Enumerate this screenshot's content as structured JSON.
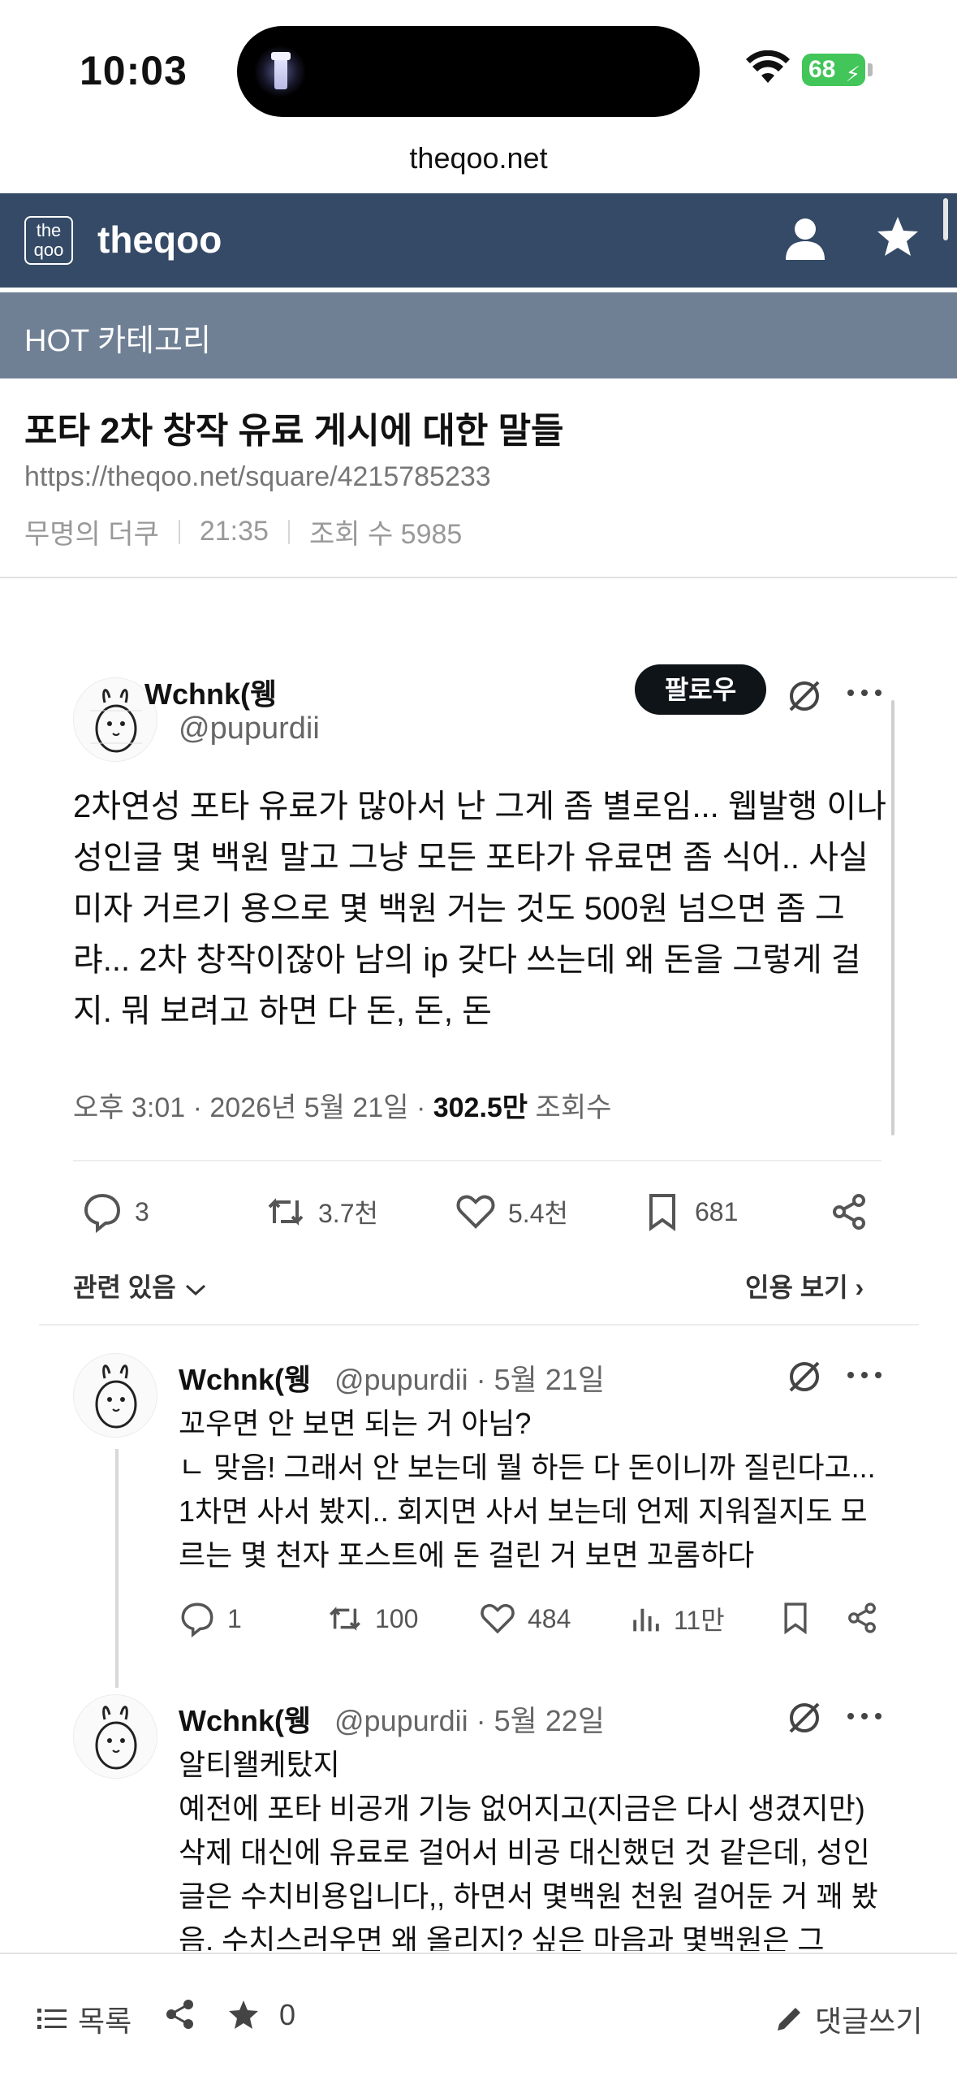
{
  "status_bar": {
    "time": "10:03",
    "battery": "68"
  },
  "browser": {
    "host": "theqoo.net"
  },
  "site": {
    "logo_text_top": "the",
    "logo_text_bottom": "qoo",
    "title": "theqoo",
    "icons": [
      "user-icon",
      "star-icon"
    ]
  },
  "category": {
    "label": "HOT 카테고리"
  },
  "article": {
    "title": "포타 2차 창작 유료 게시에 대한 말들",
    "url": "https://theqoo.net/square/4215785233",
    "author": "무명의 더쿠",
    "time": "21:35",
    "views": "조회 수 5985"
  },
  "tweet": {
    "name": "Wchnk(웽",
    "handle": "@pupurdii",
    "follow_label": "팔로우",
    "text": "2차연성 포타 유료가 많아서 난 그게 좀 별로임... 웹발행 이나 성인글 몇 백원 말고 그냥 모든 포타가 유료면 좀 식어.. 사실 미자 거르기 용으로 몇 백원 거는 것도 500원 넘으면 좀 그랴... 2차 창작이잖아 남의 ip 갖다 쓰는데 왜 돈을 그렇게 걸지. 뭐 보려고 하면 다 돈, 돈, 돈",
    "date": "오후 3:01 · 2026년 5월 21일 · ",
    "views_count": "302.5만",
    "views_label": " 조회수",
    "stats": {
      "replies": "3",
      "retweets": "3.7천",
      "likes": "5.4천",
      "bookmarks": "681"
    },
    "related_label": "관련 있음",
    "quote_label": "인용 보기 ›"
  },
  "replies": [
    {
      "name": "Wchnk(웽",
      "handle": "@pupurdii · 5월 21일",
      "text": "꼬우면 안 보면 되는 거 아님?\nㄴ 맞음! 그래서 안 보는데 뭘 하든 다 돈이니까 질린다고... 1차면 사서 봤지.. 회지면 사서 보는데 언제 지워질지도 모르는 몇 천자 포스트에 돈 걸린 거 보면 꼬롬하다",
      "stats": {
        "replies": "1",
        "retweets": "100",
        "likes": "484",
        "views": "11만"
      }
    },
    {
      "name": "Wchnk(웽",
      "handle": "@pupurdii · 5월 22일",
      "text": "알티왤케탔지\n예전에 포타 비공개 기능 없어지고(지금은 다시 생겼지만) 삭제 대신에 유료로 걸어서 비공 대신했던 것 같은데, 성인글은 수치비용입니다,, 하면서 몇백원 천원 걸어둔 거 꽤 봤음. 수치스러우면 왜 올리지? 싶은 마음과 몇백원은 그"
    }
  ],
  "bottom_bar": {
    "list_label": "목록",
    "star_count": "0",
    "comment_label": "댓글쓰기"
  },
  "colors": {
    "header_bg": "#354a66",
    "category_bg": "#6f8095",
    "battery_green": "#42c559"
  }
}
